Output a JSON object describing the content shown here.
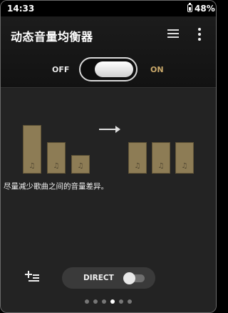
{
  "status": {
    "time": "14:33",
    "battery": "48%"
  },
  "header": {
    "title": "动态音量均衡器",
    "icons": [
      "preset-list-icon",
      "more-vert-icon"
    ]
  },
  "toggle": {
    "off_label": "OFF",
    "on_label": "ON",
    "state": "on"
  },
  "illustration": {
    "note_glyph": "♫",
    "arrow_icon": "arrow-right-icon"
  },
  "description": "尽量减少歌曲之间的音量差异。",
  "footer": {
    "add_icon": "playlist-add-icon",
    "direct_label": "DIRECT",
    "direct_state": "off",
    "page_count": 6,
    "active_page": 4
  },
  "colors": {
    "accent": "#c9a86a",
    "bar": "#8d7c55",
    "background": "#232323"
  }
}
